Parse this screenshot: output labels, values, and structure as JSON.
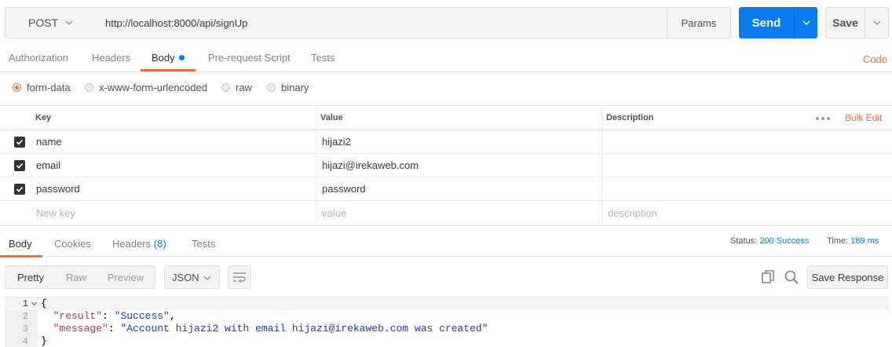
{
  "request": {
    "method": "POST",
    "url": "http://localhost:8000/api/signUp",
    "params_label": "Params",
    "send_label": "Send",
    "save_label": "Save"
  },
  "request_tabs": [
    "Authorization",
    "Headers",
    "Body",
    "Pre-request Script",
    "Tests"
  ],
  "active_request_tab": "Body",
  "code_link": "Code",
  "body_modes": [
    "form-data",
    "x-www-form-urlencoded",
    "raw",
    "binary"
  ],
  "selected_body_mode": "form-data",
  "params_table": {
    "headers": {
      "key": "Key",
      "value": "Value",
      "description": "Description"
    },
    "bulk_edit": "Bulk Edit",
    "rows": [
      {
        "checked": true,
        "key": "name",
        "value": "hijazi2",
        "description": ""
      },
      {
        "checked": true,
        "key": "email",
        "value": "hijazi@irekaweb.com",
        "description": ""
      },
      {
        "checked": true,
        "key": "password",
        "value": "password",
        "description": ""
      }
    ],
    "new_row": {
      "key": "New key",
      "value": "value",
      "description": "description"
    }
  },
  "response_tabs": {
    "body": "Body",
    "cookies": "Cookies",
    "headers": "Headers",
    "headers_count": "(8)",
    "tests": "Tests"
  },
  "response_meta": {
    "status_label": "Status:",
    "status_value": "200 Success",
    "time_label": "Time:",
    "time_value": "189 ms"
  },
  "response_toolbar": {
    "views": [
      "Pretty",
      "Raw",
      "Preview"
    ],
    "active_view": "Pretty",
    "format": "JSON",
    "save_response": "Save Response"
  },
  "response_code": {
    "line_numbers": [
      "1",
      "2",
      "3",
      "4"
    ],
    "open_brace": "{",
    "close_brace": "}",
    "result_key": "\"result\"",
    "result_value": "\"Success\"",
    "message_key": "\"message\"",
    "message_value": "\"Account hijazi2 with email hijazi@irekaweb.com was created\""
  },
  "colors": {
    "accent_orange": "#f26b3a",
    "primary_blue": "#097bed"
  }
}
